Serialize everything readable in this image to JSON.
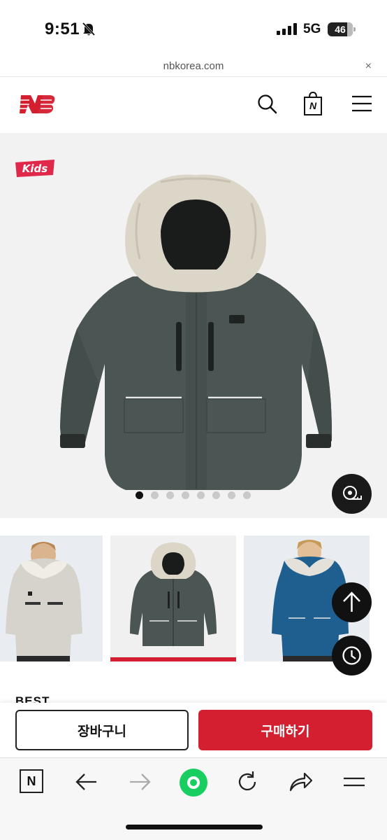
{
  "status_bar": {
    "time": "9:51",
    "network": "5G",
    "battery": "46"
  },
  "browser": {
    "url": "nbkorea.com",
    "close_label": "×"
  },
  "header": {
    "logo": "new-balance-logo",
    "icons": [
      "search-icon",
      "shopping-bag-icon",
      "menu-icon"
    ],
    "bag_letter": "N"
  },
  "hero": {
    "badge": "Kids",
    "image": "charcoal-hooded-parka-with-fur-trim",
    "carousel": {
      "total": 8,
      "active_index": 0
    },
    "size_button_icon": "measuring-tape-icon"
  },
  "thumbnails": [
    {
      "image": "boy-wearing-light-gray-parka",
      "selected": false
    },
    {
      "image": "charcoal-parka-product",
      "selected": true
    },
    {
      "image": "boy-wearing-blue-parka",
      "selected": false
    }
  ],
  "floating_buttons": [
    "arrow-up-icon",
    "clock-icon"
  ],
  "section": {
    "label": "BEST"
  },
  "actions": {
    "cart_label": "장바구니",
    "buy_label": "구매하기"
  },
  "colors": {
    "accent": "#d31f2f",
    "jacket": "#4b5654",
    "jacket_blue": "#1f5f8f",
    "fur": "#dcd6c9"
  },
  "toolbar": {
    "icons": [
      "naver-n-icon",
      "back-arrow-icon",
      "forward-arrow-icon",
      "green-home-icon",
      "refresh-icon",
      "share-icon",
      "menu-icon"
    ],
    "n_letter": "N"
  }
}
